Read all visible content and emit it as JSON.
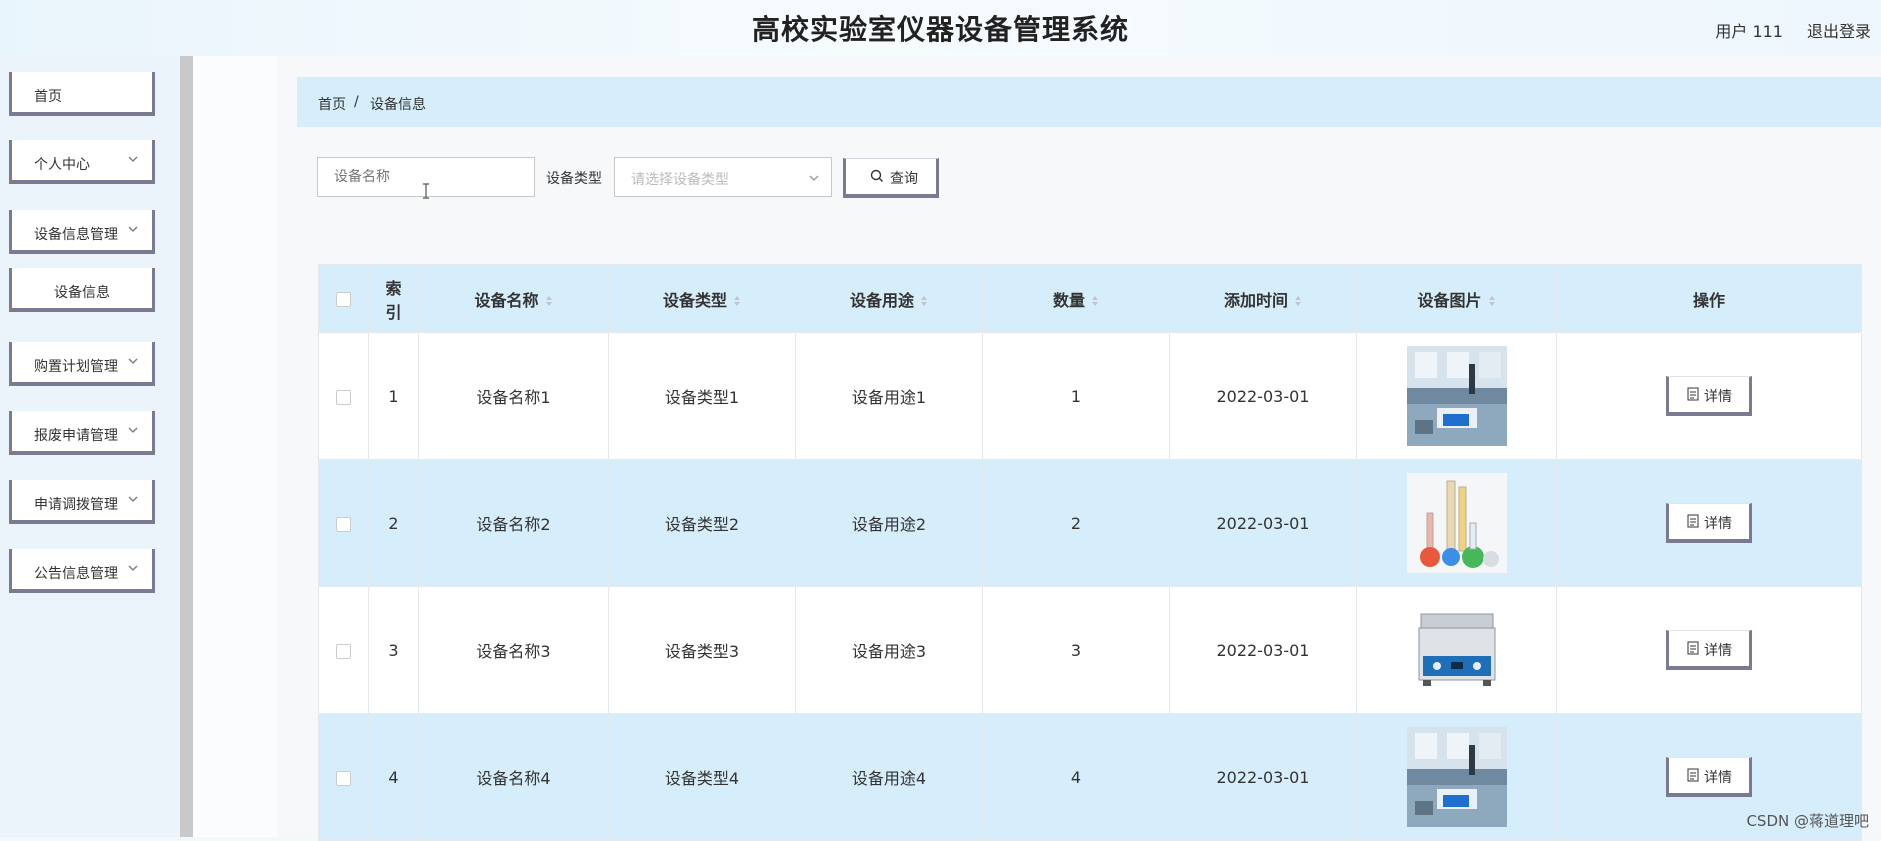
{
  "header": {
    "title": "高校实验室仪器设备管理系统",
    "user": "用户 111",
    "logout": "退出登录"
  },
  "sidebar": {
    "items": [
      {
        "label": "首页",
        "has_arrow": false
      },
      {
        "label": "个人中心",
        "has_arrow": true
      },
      {
        "label": "设备信息管理",
        "has_arrow": true
      },
      {
        "label": "设备信息",
        "has_arrow": false,
        "sub": true
      },
      {
        "label": "购置计划管理",
        "has_arrow": true
      },
      {
        "label": "报废申请管理",
        "has_arrow": true
      },
      {
        "label": "申请调拨管理",
        "has_arrow": true
      },
      {
        "label": "公告信息管理",
        "has_arrow": true
      }
    ]
  },
  "breadcrumb": {
    "home": "首页",
    "separator": "/",
    "current": "设备信息"
  },
  "search": {
    "name_placeholder": "设备名称",
    "type_label": "设备类型",
    "type_placeholder": "请选择设备类型",
    "query_label": "查询"
  },
  "table": {
    "headers": [
      "索引",
      "设备名称",
      "设备类型",
      "设备用途",
      "数量",
      "添加时间",
      "设备图片",
      "操作"
    ],
    "header_index_lines": [
      "索",
      "引"
    ],
    "rows": [
      {
        "index": "1",
        "name": "设备名称1",
        "type": "设备类型1",
        "usage": "设备用途1",
        "qty": "1",
        "date": "2022-03-01",
        "image": "lab-room",
        "action": "详情"
      },
      {
        "index": "2",
        "name": "设备名称2",
        "type": "设备类型2",
        "usage": "设备用途2",
        "qty": "2",
        "date": "2022-03-01",
        "image": "glassware",
        "action": "详情"
      },
      {
        "index": "3",
        "name": "设备名称3",
        "type": "设备类型3",
        "usage": "设备用途3",
        "qty": "3",
        "date": "2022-03-01",
        "image": "ultrasonic-cleaner",
        "action": "详情"
      },
      {
        "index": "4",
        "name": "设备名称4",
        "type": "设备类型4",
        "usage": "设备用途4",
        "qty": "4",
        "date": "2022-03-01",
        "image": "lab-room",
        "action": "详情"
      }
    ]
  },
  "watermark": "CSDN @蒋道理吧",
  "colors": {
    "accent_light": "#d6eefb",
    "button_border": "#7a7a93"
  }
}
